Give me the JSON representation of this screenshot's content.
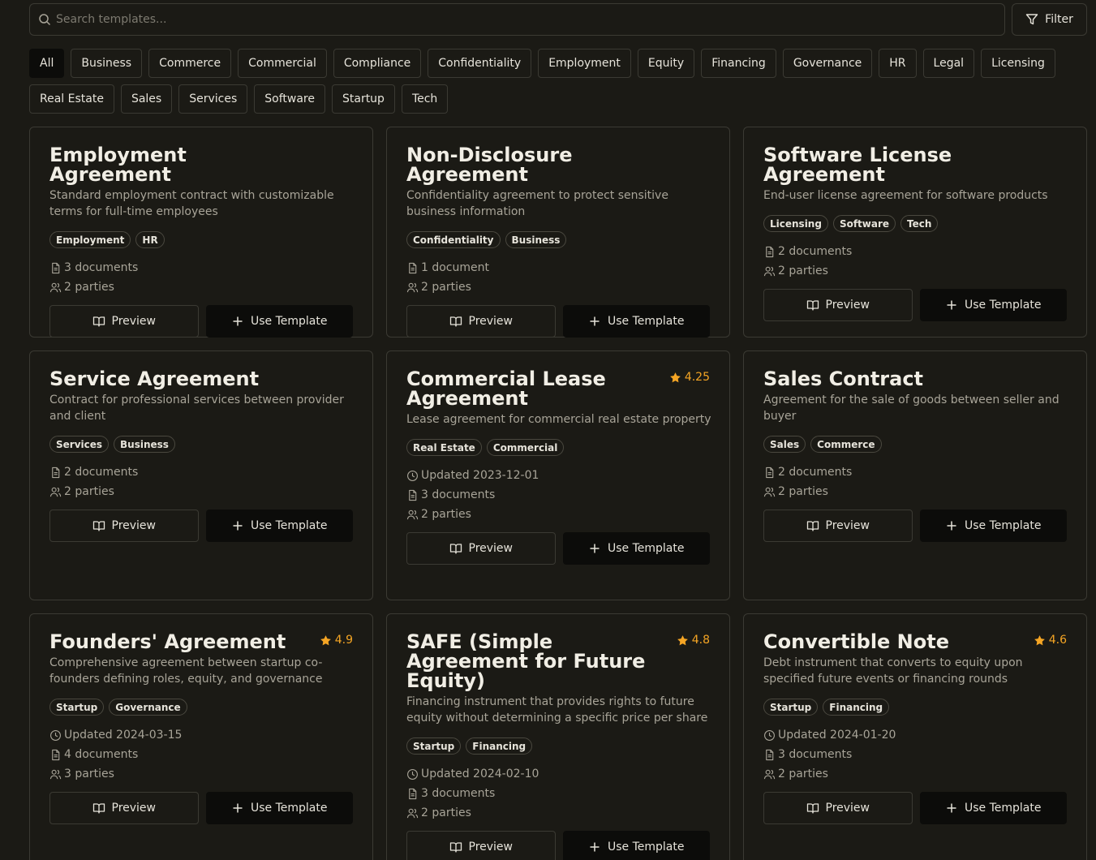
{
  "search": {
    "placeholder": "Search templates..."
  },
  "filter_button": {
    "label": "Filter"
  },
  "categories": {
    "row1": [
      "All",
      "Business",
      "Commerce",
      "Commercial",
      "Compliance",
      "Confidentiality",
      "Employment",
      "Equity",
      "Financing",
      "Governance",
      "HR",
      "Legal",
      "Licensing"
    ],
    "row2": [
      "Real Estate",
      "Sales",
      "Services",
      "Software",
      "Startup",
      "Tech"
    ],
    "active": "All"
  },
  "buttons": {
    "preview": "Preview",
    "use": "Use Template"
  },
  "icons": {
    "search": "search-icon",
    "filter": "filter-icon",
    "star": "star-icon",
    "document": "document-icon",
    "users": "users-icon",
    "clock": "clock-icon",
    "book": "book-open-icon",
    "plus": "plus-icon"
  },
  "colors": {
    "background": "#1b1a15",
    "rating": "#f5a524",
    "primary_button": "#0c0c0a"
  },
  "templates": [
    {
      "title": "Employment Agreement",
      "description": "Standard employment contract with customizable terms for full-time employees",
      "tags": [
        "Employment",
        "HR"
      ],
      "rating": null,
      "updated": null,
      "documents": "3 documents",
      "parties": "2 parties"
    },
    {
      "title": "Non-Disclosure Agreement",
      "description": "Confidentiality agreement to protect sensitive business information",
      "tags": [
        "Confidentiality",
        "Business"
      ],
      "rating": null,
      "updated": null,
      "documents": "1 document",
      "parties": "2 parties"
    },
    {
      "title": "Software License Agreement",
      "description": "End-user license agreement for software products",
      "tags": [
        "Licensing",
        "Software",
        "Tech"
      ],
      "rating": null,
      "updated": null,
      "documents": "2 documents",
      "parties": "2 parties"
    },
    {
      "title": "Service Agreement",
      "description": "Contract for professional services between provider and client",
      "tags": [
        "Services",
        "Business"
      ],
      "rating": null,
      "updated": null,
      "documents": "2 documents",
      "parties": "2 parties"
    },
    {
      "title": "Commercial Lease Agreement",
      "description": "Lease agreement for commercial real estate property",
      "tags": [
        "Real Estate",
        "Commercial"
      ],
      "rating": "4.25",
      "updated": "Updated 2023-12-01",
      "documents": "3 documents",
      "parties": "2 parties"
    },
    {
      "title": "Sales Contract",
      "description": "Agreement for the sale of goods between seller and buyer",
      "tags": [
        "Sales",
        "Commerce"
      ],
      "rating": null,
      "updated": null,
      "documents": "2 documents",
      "parties": "2 parties"
    },
    {
      "title": "Founders' Agreement",
      "description": "Comprehensive agreement between startup co-founders defining roles, equity, and governance",
      "tags": [
        "Startup",
        "Governance"
      ],
      "rating": "4.9",
      "updated": "Updated 2024-03-15",
      "documents": "4 documents",
      "parties": "3 parties"
    },
    {
      "title": "SAFE (Simple Agreement for Future Equity)",
      "description": "Financing instrument that provides rights to future equity without determining a specific price per share",
      "tags": [
        "Startup",
        "Financing"
      ],
      "rating": "4.8",
      "updated": "Updated 2024-02-10",
      "documents": "3 documents",
      "parties": "2 parties"
    },
    {
      "title": "Convertible Note",
      "description": "Debt instrument that converts to equity upon specified future events or financing rounds",
      "tags": [
        "Startup",
        "Financing"
      ],
      "rating": "4.6",
      "updated": "Updated 2024-01-20",
      "documents": "3 documents",
      "parties": "2 parties"
    }
  ]
}
